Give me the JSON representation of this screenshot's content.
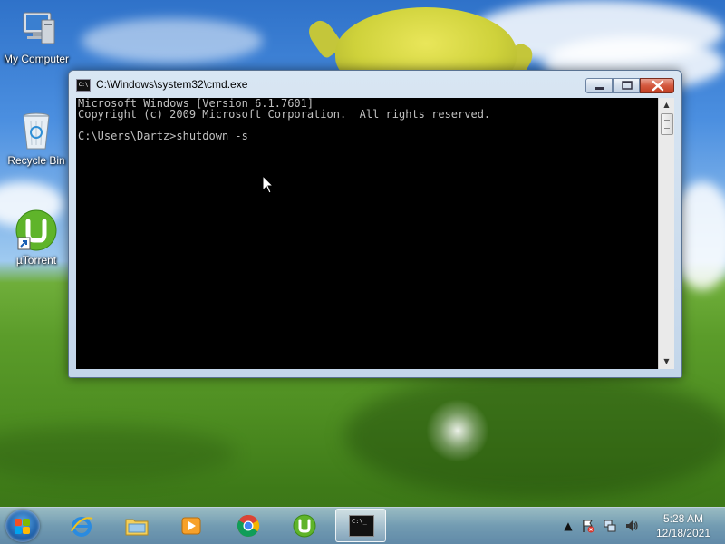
{
  "desktop": {
    "icons": [
      {
        "label": "My Computer",
        "icon": "computer-icon"
      },
      {
        "label": "Recycle Bin",
        "icon": "recycle-bin-icon"
      },
      {
        "label": "µTorrent",
        "icon": "utorrent-icon"
      }
    ]
  },
  "window": {
    "title": "C:\\Windows\\system32\\cmd.exe",
    "icon_label": "C:\\",
    "buttons": {
      "minimize": "minimize-icon",
      "maximize": "maximize-icon",
      "close": "close-icon"
    },
    "console_text": "Microsoft Windows [Version 6.1.7601]\nCopyright (c) 2009 Microsoft Corporation.  All rights reserved.\n\nC:\\Users\\Dartz>shutdown -s",
    "colors": {
      "console_bg": "#000000",
      "console_fg": "#c0c0c0"
    }
  },
  "taskbar": {
    "start": "windows-start-icon",
    "items": [
      {
        "name": "internet-explorer",
        "icon": "internet-explorer-icon"
      },
      {
        "name": "windows-explorer",
        "icon": "folder-icon"
      },
      {
        "name": "media-player",
        "icon": "media-player-icon"
      },
      {
        "name": "chrome",
        "icon": "chrome-icon"
      },
      {
        "name": "utorrent",
        "icon": "utorrent-icon"
      },
      {
        "name": "command-prompt",
        "icon": "cmd-icon",
        "active": true,
        "label": "C:\\_"
      }
    ],
    "tray": {
      "icons": [
        "show-hidden-icons-icon",
        "action-center-flag-icon",
        "network-icon",
        "volume-icon"
      ],
      "time": "5:28 AM",
      "date": "12/18/2021"
    }
  }
}
